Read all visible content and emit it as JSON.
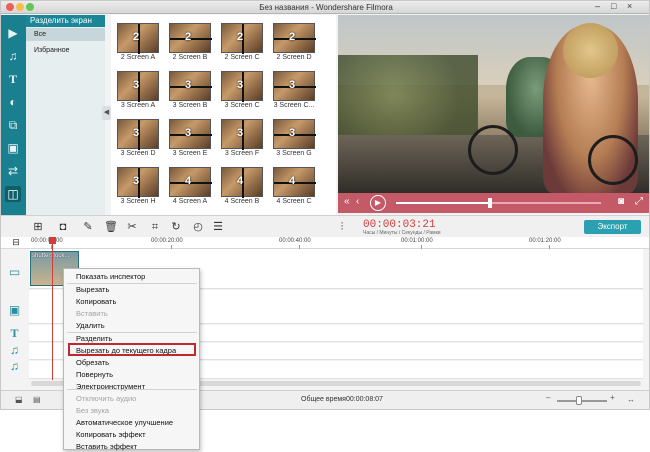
{
  "window": {
    "title": "Без названия - Wondershare Filmora"
  },
  "sidebar": {
    "header": "Разделить экран",
    "items": [
      {
        "label": "Все",
        "selected": true
      },
      {
        "label": "Избранное",
        "selected": false
      }
    ],
    "icons": [
      "media-icon",
      "music-icon",
      "text-icon",
      "filter-icon",
      "overlay-icon",
      "element-icon",
      "transition-icon",
      "split-screen-icon"
    ]
  },
  "library": {
    "items": [
      {
        "label": "2 Screen A",
        "badge": "2"
      },
      {
        "label": "2 Screen B",
        "badge": "2"
      },
      {
        "label": "2 Screen C",
        "badge": "2"
      },
      {
        "label": "2 Screen D",
        "badge": "2"
      },
      {
        "label": "3 Screen A",
        "badge": "3"
      },
      {
        "label": "3 Screen B",
        "badge": "3"
      },
      {
        "label": "3 Screen C",
        "badge": "3"
      },
      {
        "label": "3 Screen C...",
        "badge": "3"
      },
      {
        "label": "3 Screen D",
        "badge": "3"
      },
      {
        "label": "3 Screen E",
        "badge": "3"
      },
      {
        "label": "3 Screen F",
        "badge": "3"
      },
      {
        "label": "3 Screen G",
        "badge": "3"
      },
      {
        "label": "3 Screen H",
        "badge": "3"
      },
      {
        "label": "4 Screen A",
        "badge": "4"
      },
      {
        "label": "4 Screen B",
        "badge": "4"
      },
      {
        "label": "4 Screen C",
        "badge": "4"
      }
    ]
  },
  "preview": {
    "progress": 0.46
  },
  "toolbar": {
    "timecode": "00:00:03:21",
    "timecode_units": "Часы / Минуты / Секунды / Рамки",
    "export_label": "Экспорт"
  },
  "timeline": {
    "ruler": [
      "00:00:00:00",
      "00:00:20:00",
      "00:00:40:00",
      "00:01:00:00",
      "00:01:20:00"
    ],
    "clip_label": "shutterstock..."
  },
  "context_menu": {
    "items": [
      {
        "label": "Показать инспектор",
        "enabled": true
      },
      {
        "label": "Вырезать",
        "enabled": true
      },
      {
        "label": "Копировать",
        "enabled": true
      },
      {
        "label": "Вставить",
        "enabled": false
      },
      {
        "label": "Удалить",
        "enabled": true
      },
      {
        "label": "Разделить",
        "enabled": true
      },
      {
        "label": "Вырезать до текущего кадра",
        "enabled": true,
        "highlighted": true
      },
      {
        "label": "Обрезать",
        "enabled": true
      },
      {
        "label": "Повернуть",
        "enabled": true
      },
      {
        "label": "Электроинструмент",
        "enabled": true
      },
      {
        "label": "Отключить аудио",
        "enabled": false
      },
      {
        "label": "Без звука",
        "enabled": false
      },
      {
        "label": "Автоматическое улучшение",
        "enabled": true
      },
      {
        "label": "Копировать эффект",
        "enabled": true
      },
      {
        "label": "Вставить эффект",
        "enabled": true
      }
    ]
  },
  "status": {
    "total_time": "Общее время00:00:08:07"
  },
  "colors": {
    "accent": "#1a7f8e",
    "preview_controls": "#c45a68",
    "export": "#2aa0b0",
    "timecode": "#d23c3c",
    "highlight_border": "#c0282f"
  }
}
